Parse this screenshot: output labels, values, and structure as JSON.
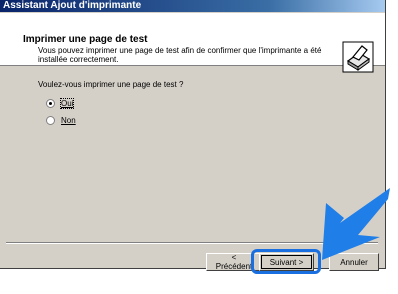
{
  "window": {
    "title": "Assistant Ajout d'imprimante"
  },
  "header": {
    "title": "Imprimer une page de test",
    "description": "Vous pouvez imprimer une page de test afin de confirmer que l'imprimante a été installée correctement."
  },
  "question": "Voulez-vous imprimer une page de test ?",
  "options": [
    {
      "label": "Oui",
      "selected": true
    },
    {
      "label": "Non",
      "selected": false
    }
  ],
  "buttons": {
    "back": "< Précédent",
    "next": "Suivant >",
    "cancel": "Annuler"
  },
  "colors": {
    "title_bar": "#0a246a",
    "highlight": "#1a6fe0",
    "arrow": "#1f7ee8"
  }
}
